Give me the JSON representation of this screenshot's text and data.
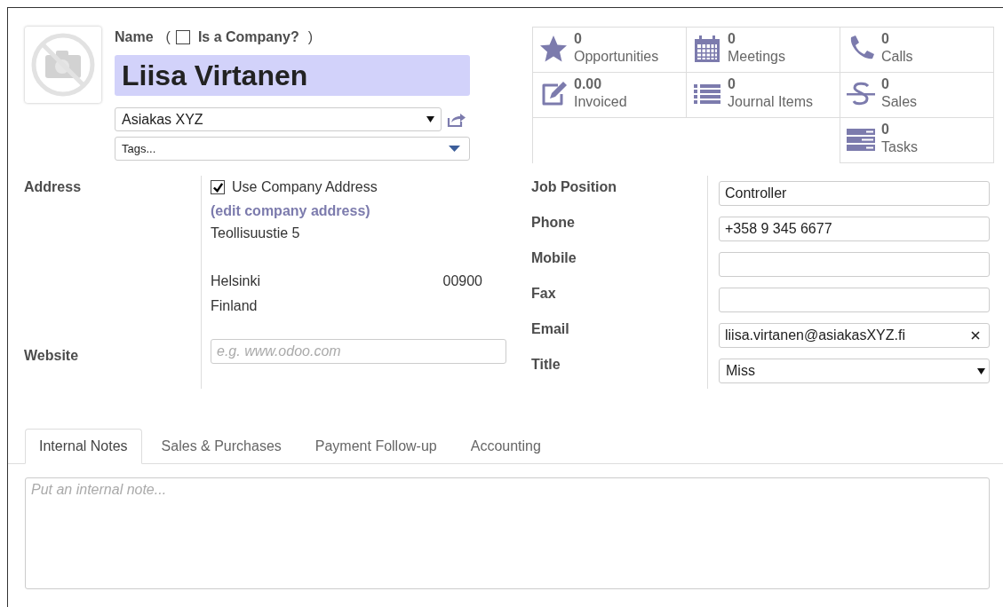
{
  "header": {
    "name_label": "Name",
    "company_checkbox": {
      "open": "(",
      "label": "Is a Company?",
      "close": ")",
      "checked": false
    },
    "name": "Liisa Virtanen",
    "company": "Asiakas XYZ",
    "tags": {
      "placeholder": "Tags..."
    }
  },
  "stats": [
    {
      "kind": "star",
      "value": "0",
      "label": "Opportunities"
    },
    {
      "kind": "calendar",
      "value": "0",
      "label": "Meetings"
    },
    {
      "kind": "phone",
      "value": "0",
      "label": "Calls"
    },
    {
      "kind": "edit",
      "value": "0.00",
      "label": "Invoiced"
    },
    {
      "kind": "list",
      "value": "0",
      "label": "Journal Items"
    },
    {
      "kind": "strike",
      "value": "0",
      "label": "Sales"
    },
    {
      "kind": "tasks",
      "value": "0",
      "label": "Tasks"
    }
  ],
  "address": {
    "label": "Address",
    "use_company_address": {
      "label": "Use Company Address",
      "checked": true
    },
    "edit_link": "(edit company address)",
    "street": "Teollisuustie 5",
    "city": "Helsinki",
    "zip": "00900",
    "country": "Finland"
  },
  "website": {
    "label": "Website",
    "placeholder": "e.g. www.odoo.com"
  },
  "fields": [
    {
      "kind": "text",
      "label": "Job Position",
      "value": "Controller"
    },
    {
      "kind": "text",
      "label": "Phone",
      "value": "+358 9 345 6677"
    },
    {
      "kind": "text",
      "label": "Mobile"
    },
    {
      "kind": "text",
      "label": "Fax"
    },
    {
      "kind": "clearable",
      "label": "Email",
      "value": "liisa.virtanen@asiakasXYZ.fi"
    },
    {
      "kind": "select",
      "label": "Title",
      "value": "Miss"
    }
  ],
  "tabs": [
    {
      "label": "Internal Notes",
      "selected": true
    },
    {
      "label": "Sales & Purchases",
      "selected": false
    },
    {
      "label": "Payment Follow-up",
      "selected": false
    },
    {
      "label": "Accounting",
      "selected": false
    }
  ],
  "notes": {
    "placeholder": "Put an internal note..."
  }
}
